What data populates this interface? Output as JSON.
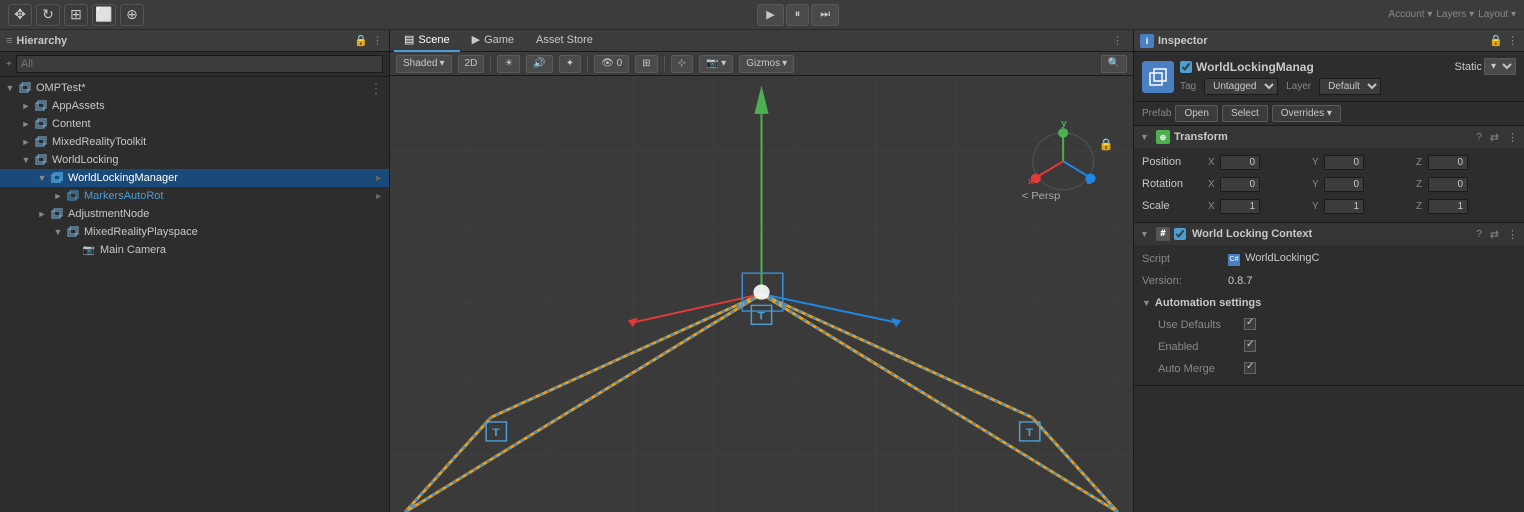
{
  "hierarchy": {
    "title": "Hierarchy",
    "search_placeholder": "All",
    "items": [
      {
        "label": "OMPTest*",
        "depth": 0,
        "expanded": true,
        "icon": "cube",
        "has_arrow": true
      },
      {
        "label": "AppAssets",
        "depth": 1,
        "expanded": false,
        "icon": "cube",
        "has_arrow": true
      },
      {
        "label": "Content",
        "depth": 1,
        "expanded": false,
        "icon": "cube",
        "has_arrow": true
      },
      {
        "label": "MixedRealityToolkit",
        "depth": 1,
        "expanded": false,
        "icon": "cube",
        "has_arrow": true
      },
      {
        "label": "WorldLocking",
        "depth": 1,
        "expanded": true,
        "icon": "cube",
        "has_arrow": true
      },
      {
        "label": "WorldLockingManager",
        "depth": 2,
        "expanded": true,
        "icon": "cube",
        "selected": true,
        "has_arrow": true
      },
      {
        "label": "MarkersAutoRot",
        "depth": 3,
        "expanded": false,
        "icon": "cube",
        "blue": true,
        "has_arrow": true
      },
      {
        "label": "AdjustmentNode",
        "depth": 2,
        "expanded": false,
        "icon": "cube",
        "has_arrow": true
      },
      {
        "label": "MixedRealityPlayspace",
        "depth": 3,
        "expanded": true,
        "icon": "cube",
        "has_arrow": true
      },
      {
        "label": "Main Camera",
        "depth": 4,
        "expanded": false,
        "icon": "camera",
        "has_arrow": false
      }
    ]
  },
  "scene_tabs": [
    {
      "label": "Scene",
      "icon": "▤",
      "active": true
    },
    {
      "label": "Game",
      "icon": "▶",
      "active": false
    },
    {
      "label": "Asset Store",
      "icon": "🏪",
      "active": false
    }
  ],
  "scene_toolbar": {
    "shading": "Shaded",
    "mode_2d": "2D",
    "gizmos": "Gizmos",
    "persp": "< Persp"
  },
  "inspector": {
    "title": "Inspector",
    "object_name": "WorldLockingManag",
    "static_label": "Static",
    "tag_label": "Tag",
    "tag_value": "Untagged",
    "layer_label": "Layer",
    "layer_value": "Default",
    "prefab_label": "Prefab",
    "open_label": "Open",
    "select_label": "Select",
    "overrides_label": "Overrides",
    "transform": {
      "title": "Transform",
      "position_label": "Position",
      "rotation_label": "Rotation",
      "scale_label": "Scale",
      "pos_x": "0",
      "pos_y": "0",
      "pos_z": "0",
      "rot_x": "0",
      "rot_y": "0",
      "rot_z": "0",
      "scale_x": "1",
      "scale_y": "1",
      "scale_z": "1"
    },
    "world_locking_context": {
      "title": "World Locking Context",
      "component_name": "World Locking Context 0",
      "script_label": "Script",
      "script_value": "WorldLockingC",
      "version_label": "Version:",
      "version_value": "0.8.7",
      "automation_label": "Automation settings",
      "use_defaults_label": "Use Defaults",
      "enabled_label": "Enabled",
      "auto_merge_label": "Auto Merge"
    }
  }
}
